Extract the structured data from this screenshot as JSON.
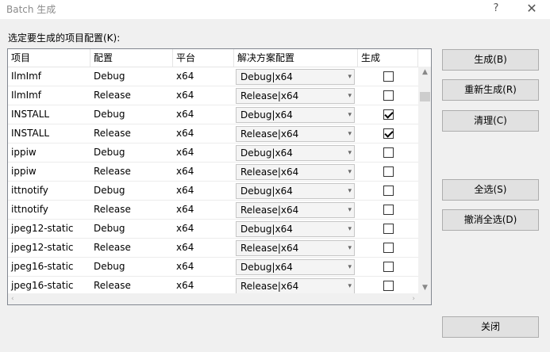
{
  "window": {
    "title": "Batch 生成",
    "help_label": "?",
    "close_label": "✕"
  },
  "prompt_label": "选定要生成的项目配置(K):",
  "grid": {
    "columns": [
      "项目",
      "配置",
      "平台",
      "解决方案配置",
      "生成"
    ],
    "rows": [
      {
        "project": "IlmImf",
        "config": "Debug",
        "platform": "x64",
        "solution_config": "Debug|x64",
        "build": false
      },
      {
        "project": "IlmImf",
        "config": "Release",
        "platform": "x64",
        "solution_config": "Release|x64",
        "build": false
      },
      {
        "project": "INSTALL",
        "config": "Debug",
        "platform": "x64",
        "solution_config": "Debug|x64",
        "build": true
      },
      {
        "project": "INSTALL",
        "config": "Release",
        "platform": "x64",
        "solution_config": "Release|x64",
        "build": true
      },
      {
        "project": "ippiw",
        "config": "Debug",
        "platform": "x64",
        "solution_config": "Debug|x64",
        "build": false
      },
      {
        "project": "ippiw",
        "config": "Release",
        "platform": "x64",
        "solution_config": "Release|x64",
        "build": false
      },
      {
        "project": "ittnotify",
        "config": "Debug",
        "platform": "x64",
        "solution_config": "Debug|x64",
        "build": false
      },
      {
        "project": "ittnotify",
        "config": "Release",
        "platform": "x64",
        "solution_config": "Release|x64",
        "build": false
      },
      {
        "project": "jpeg12-static",
        "config": "Debug",
        "platform": "x64",
        "solution_config": "Debug|x64",
        "build": false
      },
      {
        "project": "jpeg12-static",
        "config": "Release",
        "platform": "x64",
        "solution_config": "Release|x64",
        "build": false
      },
      {
        "project": "jpeg16-static",
        "config": "Debug",
        "platform": "x64",
        "solution_config": "Debug|x64",
        "build": false
      },
      {
        "project": "jpeg16-static",
        "config": "Release",
        "platform": "x64",
        "solution_config": "Release|x64",
        "build": false
      }
    ]
  },
  "buttons": {
    "build": "生成(B)",
    "rebuild": "重新生成(R)",
    "clean": "清理(C)",
    "select_all": "全选(S)",
    "deselect_all": "撤消全选(D)",
    "close": "关闭"
  },
  "icons": {
    "combo_arrow": "chevron-down-icon",
    "scroll_up": "scroll-up-arrow-icon",
    "scroll_down": "scroll-down-arrow-icon",
    "scroll_left": "scroll-left-arrow-icon",
    "scroll_right": "scroll-right-arrow-icon"
  }
}
